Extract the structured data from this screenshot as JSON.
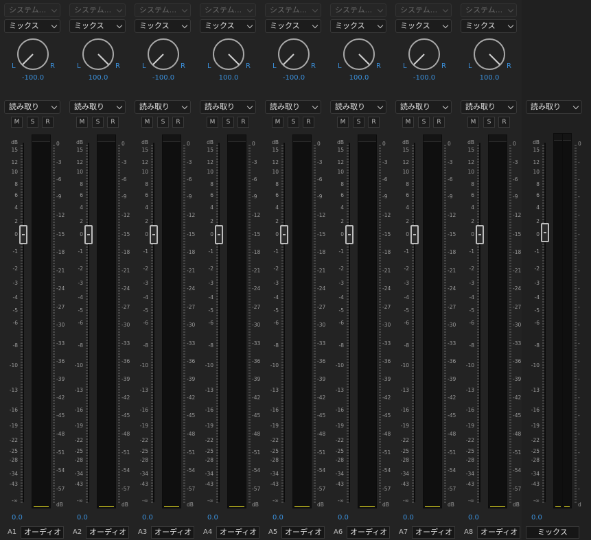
{
  "strips": [
    {
      "track_id": "A1",
      "hardware": "システム...",
      "output": "ミックス",
      "pan_l": "L",
      "pan_r": "R",
      "pan_value": "-100.0",
      "automation": "読み取り",
      "mute": "M",
      "solo": "S",
      "record": "R",
      "volume": "0.0",
      "name": "オーディオ"
    },
    {
      "track_id": "A2",
      "hardware": "システム...",
      "output": "ミックス",
      "pan_l": "L",
      "pan_r": "R",
      "pan_value": "100.0",
      "automation": "読み取り",
      "mute": "M",
      "solo": "S",
      "record": "R",
      "volume": "0.0",
      "name": "オーディオ"
    },
    {
      "track_id": "A3",
      "hardware": "システム...",
      "output": "ミックス",
      "pan_l": "L",
      "pan_r": "R",
      "pan_value": "-100.0",
      "automation": "読み取り",
      "mute": "M",
      "solo": "S",
      "record": "R",
      "volume": "0.0",
      "name": "オーディオ"
    },
    {
      "track_id": "A4",
      "hardware": "システム...",
      "output": "ミックス",
      "pan_l": "L",
      "pan_r": "R",
      "pan_value": "100.0",
      "automation": "読み取り",
      "mute": "M",
      "solo": "S",
      "record": "R",
      "volume": "0.0",
      "name": "オーディオ"
    },
    {
      "track_id": "A5",
      "hardware": "システム...",
      "output": "ミックス",
      "pan_l": "L",
      "pan_r": "R",
      "pan_value": "-100.0",
      "automation": "読み取り",
      "mute": "M",
      "solo": "S",
      "record": "R",
      "volume": "0.0",
      "name": "オーディオ"
    },
    {
      "track_id": "A6",
      "hardware": "システム...",
      "output": "ミックス",
      "pan_l": "L",
      "pan_r": "R",
      "pan_value": "100.0",
      "automation": "読み取り",
      "mute": "M",
      "solo": "S",
      "record": "R",
      "volume": "0.0",
      "name": "オーディオ"
    },
    {
      "track_id": "A7",
      "hardware": "システム...",
      "output": "ミックス",
      "pan_l": "L",
      "pan_r": "R",
      "pan_value": "-100.0",
      "automation": "読み取り",
      "mute": "M",
      "solo": "S",
      "record": "R",
      "volume": "0.0",
      "name": "オーディオ"
    },
    {
      "track_id": "A8",
      "hardware": "システム...",
      "output": "ミックス",
      "pan_l": "L",
      "pan_r": "R",
      "pan_value": "100.0",
      "automation": "読み取り",
      "mute": "M",
      "solo": "S",
      "record": "R",
      "volume": "0.0",
      "name": "オーディオ"
    }
  ],
  "master": {
    "automation": "読み取り",
    "volume": "0.0",
    "name": "ミックス"
  },
  "fader_scale": [
    "dB",
    "15",
    "12",
    "10",
    "8",
    "6",
    "4",
    "2",
    "0",
    "-1",
    "-2",
    "-3",
    "-4",
    "-5",
    "-6",
    "-8",
    "-10",
    "-13",
    "-16",
    "-19",
    "-22",
    "-25",
    "-28",
    "-34",
    "-43",
    "-∞"
  ],
  "meter_scale": [
    "0",
    "-3",
    "-6",
    "-9",
    "-12",
    "-15",
    "-18",
    "-21",
    "-24",
    "-27",
    "-30",
    "-33",
    "-36",
    "-39",
    "-42",
    "-45",
    "-48",
    "-51",
    "-54",
    "-57",
    "dB"
  ],
  "master_meter_scale": [
    "0",
    "-",
    "-",
    "-",
    "-",
    "-",
    "-",
    "-",
    "-",
    "-",
    "-",
    "-",
    "-",
    "-",
    "-",
    "-",
    "-",
    "-",
    "-",
    "-",
    "d"
  ],
  "colors": {
    "accent": "#3b8fd9",
    "meter_level": "#d8d020",
    "panel": "#232323"
  }
}
